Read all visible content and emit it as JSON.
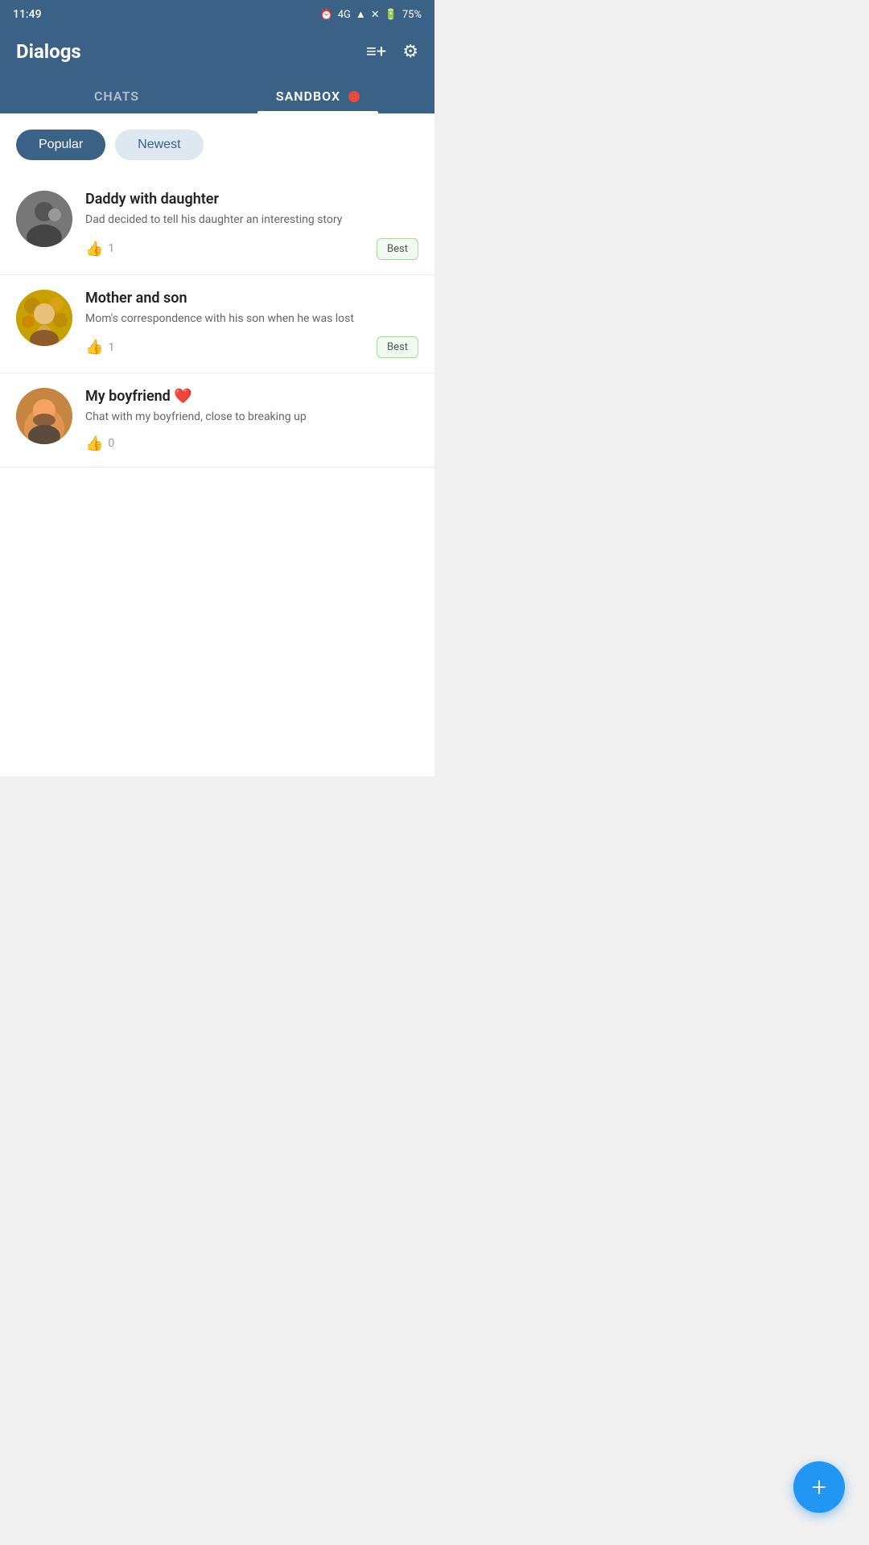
{
  "statusBar": {
    "time": "11:49",
    "network": "4G",
    "battery": "75%"
  },
  "header": {
    "title": "Dialogs",
    "newChatIcon": "≡+",
    "settingsIcon": "⚙"
  },
  "tabs": [
    {
      "id": "chats",
      "label": "CHATS",
      "active": false
    },
    {
      "id": "sandbox",
      "label": "SANDBOX",
      "active": true,
      "hasDot": true
    }
  ],
  "filters": [
    {
      "id": "popular",
      "label": "Popular",
      "active": true
    },
    {
      "id": "newest",
      "label": "Newest",
      "active": false
    }
  ],
  "chatItems": [
    {
      "id": 1,
      "title": "Daddy with daughter",
      "description": "Dad decided to tell his daughter an interesting story",
      "likes": 1,
      "badge": "Best",
      "avatarType": "dad"
    },
    {
      "id": 2,
      "title": "Mother and son",
      "description": "Mom's correspondence with his son when he was lost",
      "likes": 1,
      "badge": "Best",
      "avatarType": "mom"
    },
    {
      "id": 3,
      "title": "My boyfriend ❤️",
      "description": "Chat with my boyfriend, close to breaking up",
      "likes": 0,
      "badge": null,
      "avatarType": "bf"
    }
  ],
  "fab": {
    "label": "+"
  }
}
